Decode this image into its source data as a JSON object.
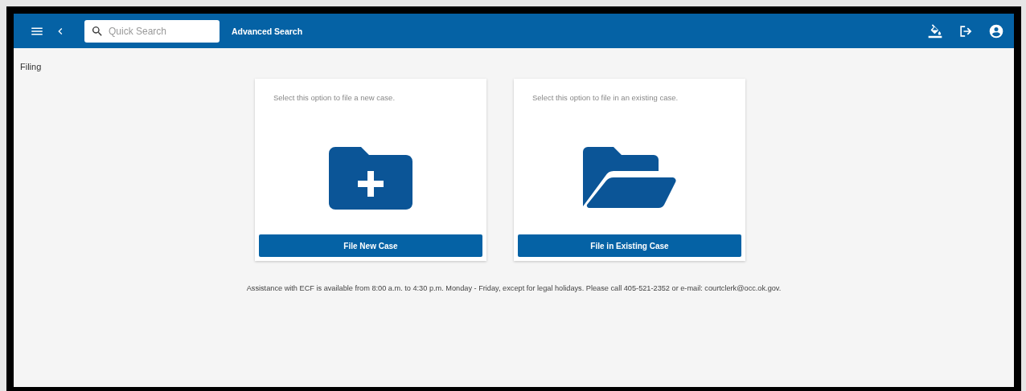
{
  "header": {
    "search": {
      "placeholder": "Quick Search"
    },
    "advanced_search": "Advanced Search"
  },
  "page_title": "Filing",
  "cards": [
    {
      "kind": "new",
      "description": "Select this option to file a new case.",
      "button": "File New Case"
    },
    {
      "kind": "existing",
      "description": "Select this option to file in an existing case.",
      "button": "File in Existing Case"
    }
  ],
  "assistance": "Assistance with ECF is available from 8:00 a.m. to 4:30 p.m. Monday - Friday, except for legal holidays. Please call 405-521-2352 or e-mail: courtclerk@occ.ok.gov."
}
